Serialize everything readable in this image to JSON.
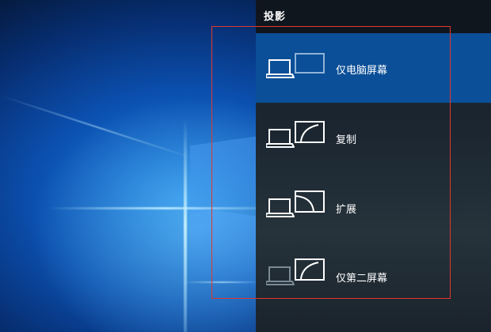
{
  "panel": {
    "title": "投影",
    "options": [
      {
        "label": "仅电脑屏幕",
        "icon": "pc-screen-only-icon",
        "selected": true
      },
      {
        "label": "复制",
        "icon": "duplicate-icon",
        "selected": false
      },
      {
        "label": "扩展",
        "icon": "extend-icon",
        "selected": false
      },
      {
        "label": "仅第二屏幕",
        "icon": "second-screen-only-icon",
        "selected": false
      }
    ]
  },
  "colors": {
    "selected_background": "#0a4f97",
    "highlight_border": "#e0382f",
    "panel_background": "#1b2631"
  }
}
